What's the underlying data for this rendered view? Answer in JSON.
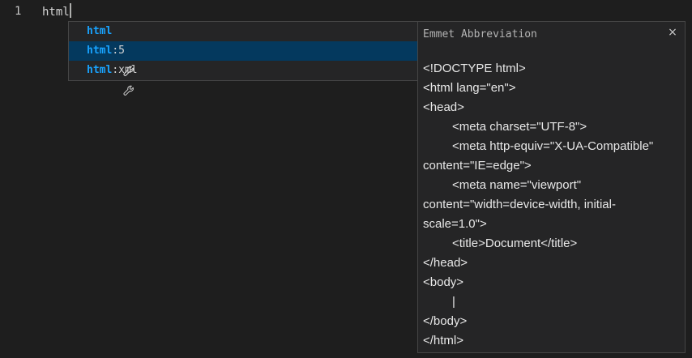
{
  "editor": {
    "line_number": "1",
    "line_text": "html"
  },
  "suggestions": [
    {
      "match": "html",
      "rest": "",
      "icon": "wrench-icon"
    },
    {
      "match": "html",
      "rest": ":5",
      "icon": "wrench-icon",
      "selected": true
    },
    {
      "match": "html",
      "rest": ":xml",
      "icon": "wrench-icon"
    }
  ],
  "details": {
    "title": "Emmet Abbreviation",
    "close_glyph": "×",
    "lines": [
      "<!DOCTYPE html>",
      "<html lang=\"en\">",
      "<head>",
      "<meta charset=\"UTF-8\">",
      "<meta http-equiv=\"X-UA-Compatible\"",
      "content=\"IE=edge\">",
      "<meta name=\"viewport\"",
      "content=\"width=device-width, initial-",
      "scale=1.0\">",
      "<title>Document</title>",
      "</head>",
      "<body>",
      "|",
      "</body>",
      "</html>"
    ]
  },
  "colors": {
    "background": "#1e1e1e",
    "widget_background": "#252526",
    "selection": "#04395e",
    "match_highlight": "#18a3ff"
  }
}
